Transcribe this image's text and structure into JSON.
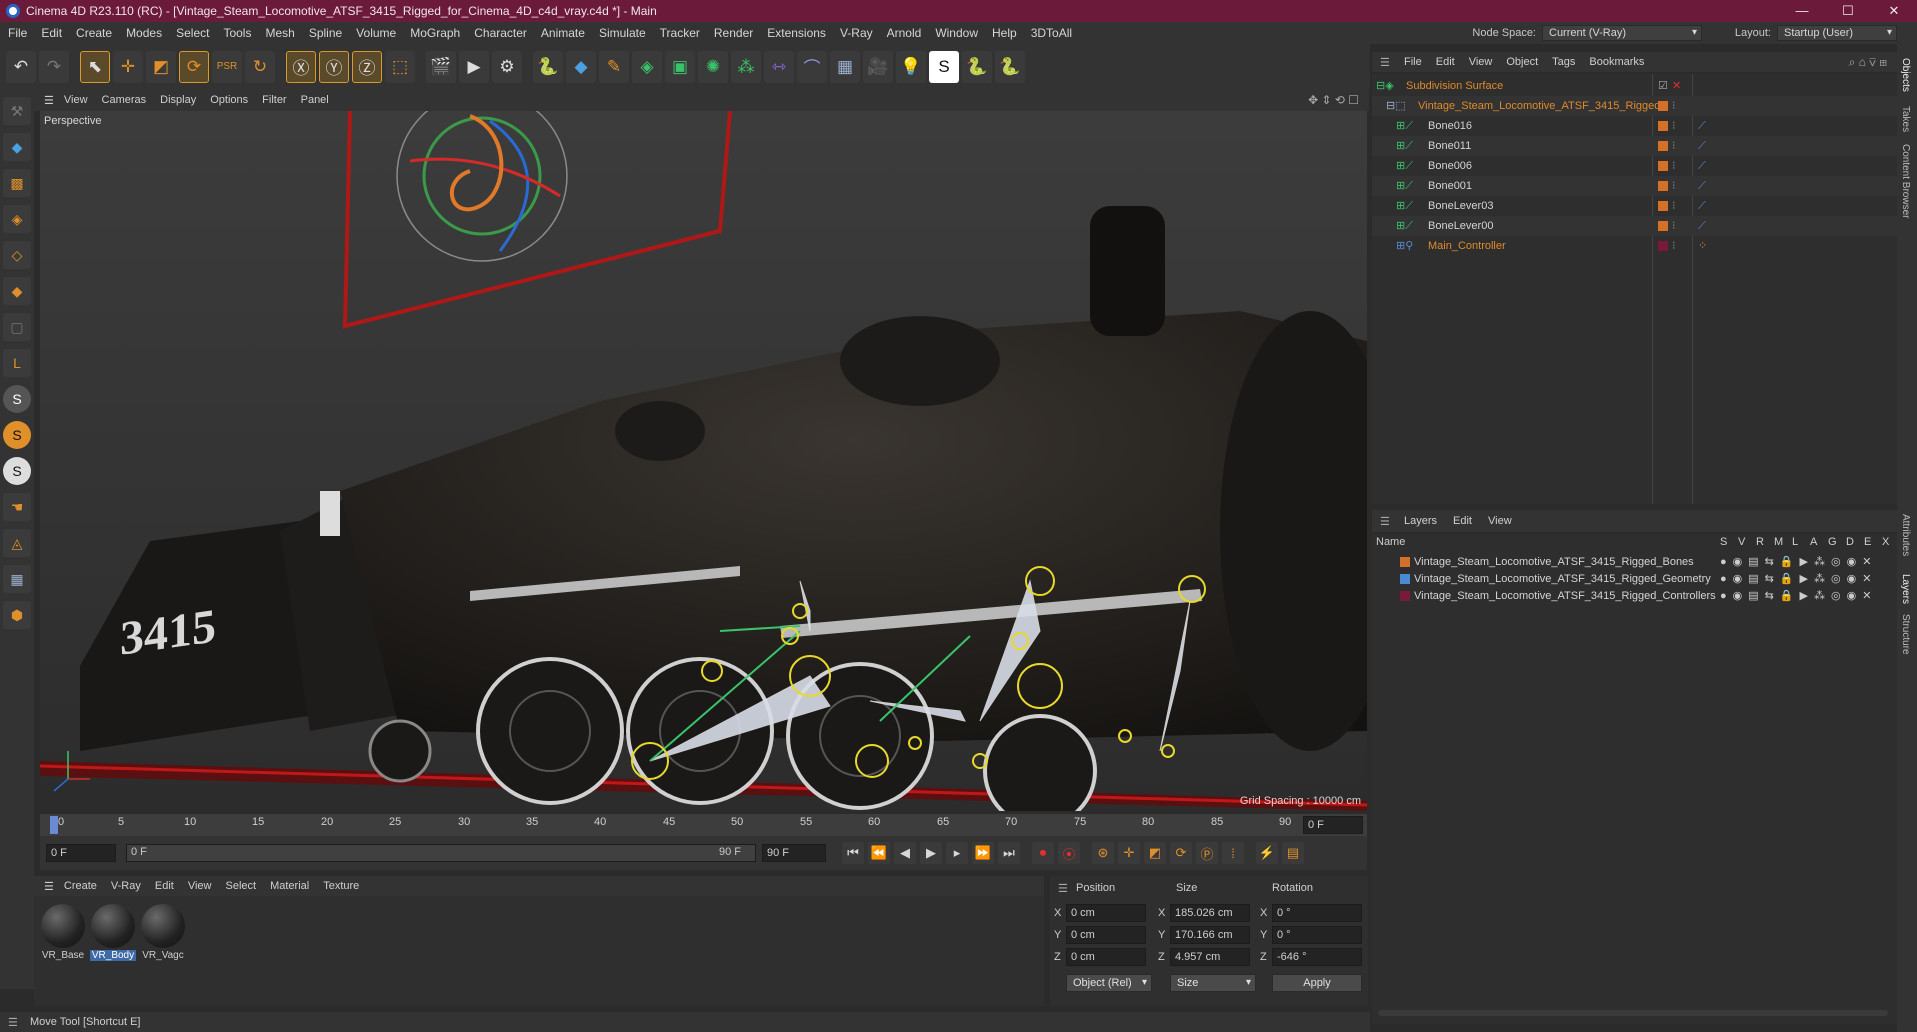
{
  "window": {
    "title": "Cinema 4D R23.110 (RC) - [Vintage_Steam_Locomotive_ATSF_3415_Rigged_for_Cinema_4D_c4d_vray.c4d *] - Main",
    "min": "—",
    "max": "☐",
    "close": "✕"
  },
  "menubar": {
    "items": [
      "File",
      "Edit",
      "Create",
      "Modes",
      "Select",
      "Tools",
      "Mesh",
      "Spline",
      "Volume",
      "MoGraph",
      "Character",
      "Animate",
      "Simulate",
      "Tracker",
      "Render",
      "Extensions",
      "V-Ray",
      "Arnold",
      "Window",
      "Help",
      "3DToAll"
    ],
    "node_space_label": "Node Space:",
    "node_space_value": "Current (V-Ray)",
    "layout_label": "Layout:",
    "layout_value": "Startup (User)"
  },
  "viewport": {
    "menu": [
      "View",
      "Cameras",
      "Display",
      "Options",
      "Filter",
      "Panel"
    ],
    "label": "Perspective",
    "grid_spacing": "Grid Spacing : 10000 cm",
    "locomotive_number": "3415"
  },
  "timeline": {
    "ticks": [
      "0",
      "5",
      "10",
      "15",
      "20",
      "25",
      "30",
      "35",
      "40",
      "45",
      "50",
      "55",
      "60",
      "65",
      "70",
      "75",
      "80",
      "85",
      "90"
    ],
    "current_frame": "0 F",
    "start_field": "0 F",
    "range_start": "0 F",
    "range_end": "90 F",
    "end_field": "90 F"
  },
  "materials": {
    "menu": [
      "Create",
      "V-Ray",
      "Edit",
      "View",
      "Select",
      "Material",
      "Texture"
    ],
    "items": [
      {
        "label": "VR_Base"
      },
      {
        "label": "VR_Body"
      },
      {
        "label": "VR_Vagc"
      }
    ]
  },
  "coords": {
    "headers": {
      "position": "Position",
      "size": "Size",
      "rotation": "Rotation"
    },
    "axes": [
      "X",
      "Y",
      "Z"
    ],
    "rotation_axes": [
      "X",
      "Y",
      "Z"
    ],
    "position": [
      "0 cm",
      "0 cm",
      "0 cm"
    ],
    "size": [
      "185.026 cm",
      "170.166 cm",
      "4.957 cm"
    ],
    "rotation": [
      "0 °",
      "0 °",
      "-646 °"
    ],
    "mode": "Object (Rel)",
    "size_mode": "Size",
    "apply": "Apply"
  },
  "status": "Move Tool [Shortcut E]",
  "objects": {
    "menu": [
      "File",
      "Edit",
      "View",
      "Object",
      "Tags",
      "Bookmarks"
    ],
    "rows": [
      {
        "name": "Subdivision Surface",
        "highlight": true
      },
      {
        "name": "Vintage_Steam_Locomotive_ATSF_3415_Rigged",
        "highlight": true
      },
      {
        "name": "Bone016",
        "highlight": false
      },
      {
        "name": "Bone011",
        "highlight": false
      },
      {
        "name": "Bone006",
        "highlight": false
      },
      {
        "name": "Bone001",
        "highlight": false
      },
      {
        "name": "BoneLever03",
        "highlight": false
      },
      {
        "name": "BoneLever00",
        "highlight": false
      },
      {
        "name": "Main_Controller",
        "highlight": true
      }
    ]
  },
  "layers": {
    "menu": [
      "Layers",
      "Edit",
      "View"
    ],
    "name_header": "Name",
    "col_headers": [
      "S",
      "V",
      "R",
      "M",
      "L",
      "A",
      "G",
      "D",
      "E",
      "X"
    ],
    "rows": [
      {
        "name": "Vintage_Steam_Locomotive_ATSF_3415_Rigged_Bones",
        "color": "#d4702a"
      },
      {
        "name": "Vintage_Steam_Locomotive_ATSF_3415_Rigged_Geometry",
        "color": "#4a8ad4"
      },
      {
        "name": "Vintage_Steam_Locomotive_ATSF_3415_Rigged_Controllers",
        "color": "#7a1a3a"
      }
    ]
  },
  "side_tabs": [
    "Objects",
    "Takes",
    "Content Browser",
    "Attributes",
    "Layers",
    "Structure"
  ]
}
